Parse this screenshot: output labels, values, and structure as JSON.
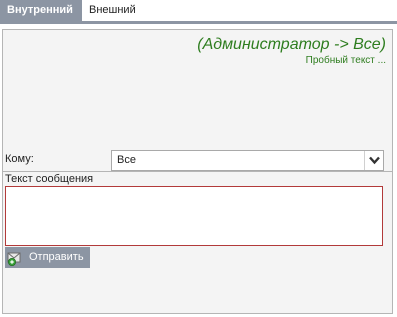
{
  "tabs": [
    {
      "label": "Внутренний",
      "active": true
    },
    {
      "label": "Внешний",
      "active": false
    }
  ],
  "messages": {
    "header": "(Администратор -> Все)",
    "text": "Пробный текст ..."
  },
  "form": {
    "to_label": "Кому:",
    "to_value": "Все",
    "text_label": "Текст сообщения",
    "text_value": "",
    "send_label": "Отправить"
  },
  "colors": {
    "tab_active_bg": "#8c95a3",
    "message_green": "#2e7d1f",
    "textarea_border": "#b23a3a",
    "button_bg": "#8c95a3"
  },
  "icons": {
    "send": "send-message-icon",
    "dropdown": "chevron-down-icon"
  }
}
